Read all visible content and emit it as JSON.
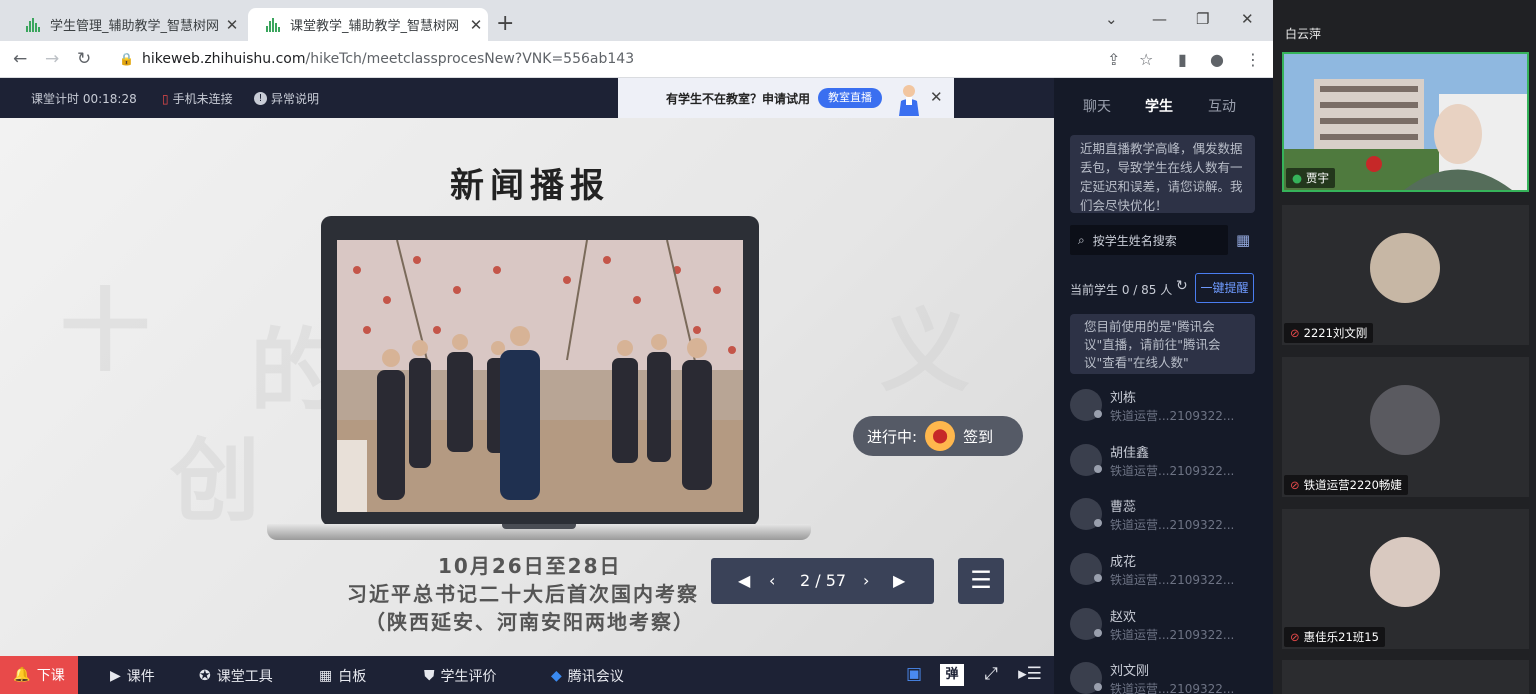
{
  "browser": {
    "tabs": [
      {
        "title": "学生管理_辅助教学_智慧树网",
        "active": false
      },
      {
        "title": "课堂教学_辅助教学_智慧树网",
        "active": true
      }
    ],
    "url_host": "hikeweb.zhihuishu.com",
    "url_path": "/hikeTch/meetclassprocesNew?VNK=556ab143"
  },
  "header": {
    "timer": "课堂计时 00:18:28",
    "phone_status": "手机未连接",
    "abnormal": "异常说明",
    "promo_text": "有学生不在教室？申请试用",
    "promo_button": "教室直播"
  },
  "slide": {
    "title": "新闻播报",
    "caption_date": "10月26日至28日",
    "caption_line2": "习近平总书记二十大后首次国内考察",
    "caption_line3": "（陕西延安、河南安阳两地考察）",
    "signin_status": "进行中:",
    "signin_label": "签到",
    "page": "2 / 57"
  },
  "toolbar": {
    "end_class": "下课",
    "courseware": "课件",
    "class_tools": "课堂工具",
    "whiteboard": "白板",
    "evaluation": "学生评价",
    "tencent": "腾讯会议",
    "danmu": "弹"
  },
  "panel": {
    "tabs": [
      "聊天",
      "学生",
      "互动"
    ],
    "notice": "近期直播教学高峰，偶发数据丢包，导致学生在线人数有一定延迟和误差，请您谅解。我们会尽快优化！",
    "search_placeholder": "按学生姓名搜索",
    "count_label": "当前学生 0 / 85 人",
    "remind_button": "一键提醒",
    "tip": "您目前使用的是\"腾讯会议\"直播，请前往\"腾讯会议\"查看\"在线人数\"",
    "students": [
      {
        "name": "刘栋",
        "sub": "铁道运营...2109322..."
      },
      {
        "name": "胡佳鑫",
        "sub": "铁道运营...2109322..."
      },
      {
        "name": "曹蕊",
        "sub": "铁道运营...2109322..."
      },
      {
        "name": "成花",
        "sub": "铁道运营...2109322..."
      },
      {
        "name": "赵欢",
        "sub": "铁道运营...2109322..."
      },
      {
        "name": "刘文刚",
        "sub": "铁道运营...2109322..."
      }
    ]
  },
  "meeting": {
    "host_name": "白云萍",
    "participants": [
      {
        "name": "贾宇"
      },
      {
        "name": "2221刘文刚"
      },
      {
        "name": "铁道运营2220畅婕"
      },
      {
        "name": "惠佳乐21班15"
      }
    ]
  }
}
